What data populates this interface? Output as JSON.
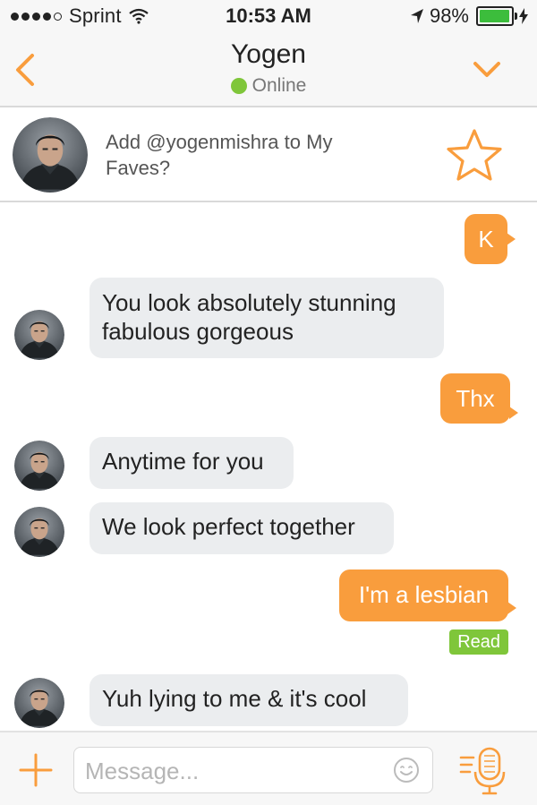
{
  "status_bar": {
    "carrier": "Sprint",
    "time": "10:53 AM",
    "battery": "98%",
    "battery_level": 0.98,
    "icons": [
      "signal-dots-icon",
      "wifi-icon",
      "location-arrow-icon",
      "battery-icon",
      "charging-bolt-icon"
    ]
  },
  "header": {
    "name": "Yogen",
    "status": "Online",
    "icons": [
      "back-chevron-icon",
      "chevron-down-icon"
    ]
  },
  "faves": {
    "text": "Add @yogenmishra to My Faves?",
    "icons": [
      "avatar",
      "star-icon"
    ]
  },
  "messages": [
    {
      "from": "me",
      "text": "K"
    },
    {
      "from": "them",
      "text": "You look absolutely stunning",
      "text2": "fabulous gorgeous"
    },
    {
      "from": "me",
      "text": "Thx"
    },
    {
      "from": "them",
      "text": "Anytime for you"
    },
    {
      "from": "them",
      "text": "We look perfect together"
    },
    {
      "from": "me",
      "text": "I'm a lesbian",
      "receipt": "Read"
    },
    {
      "from": "them",
      "text": "Yuh lying to me & it's cool"
    }
  ],
  "input": {
    "placeholder": "Message...",
    "value": "",
    "icons": [
      "plus-icon",
      "smiley-icon",
      "microphone-icon"
    ]
  },
  "colors": {
    "accent": "#f99d3d",
    "online": "#7fc63a",
    "incoming_bubble": "#ebedef",
    "outgoing_bubble": "#f99d3d",
    "read_badge": "#7fc63a"
  }
}
